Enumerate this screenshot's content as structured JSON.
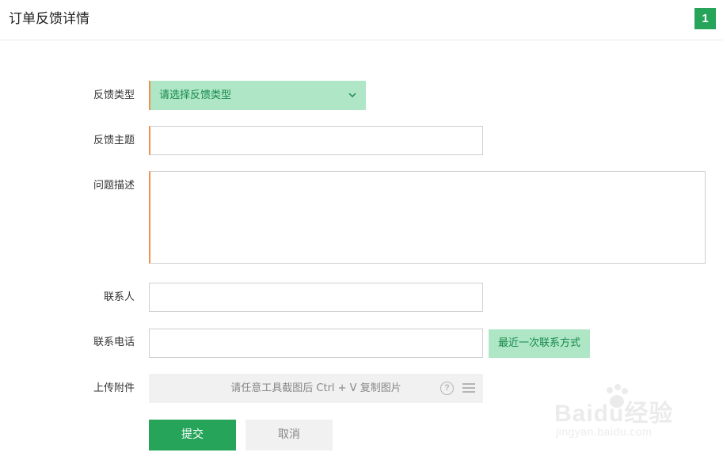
{
  "header": {
    "title": "订单反馈详情",
    "step": "1"
  },
  "form": {
    "type_label": "反馈类型",
    "type_value": "请选择反馈类型",
    "subject_label": "反馈主题",
    "subject_value": "",
    "description_label": "问题描述",
    "description_value": "",
    "contact_label": "联系人",
    "contact_value": "",
    "phone_label": "联系电话",
    "phone_value": "",
    "recent_contact_button": "最近一次联系方式",
    "attachment_label": "上传附件",
    "attachment_hint": "请任意工具截图后 Ctrl + V 复制图片"
  },
  "actions": {
    "submit": "提交",
    "cancel": "取消"
  },
  "watermark": {
    "brand": "Baidu经验",
    "url": "jingyan.baidu.com"
  },
  "colors": {
    "primary": "#25a45a",
    "light_green": "#aee6c6",
    "required_marker": "#f0914a"
  }
}
